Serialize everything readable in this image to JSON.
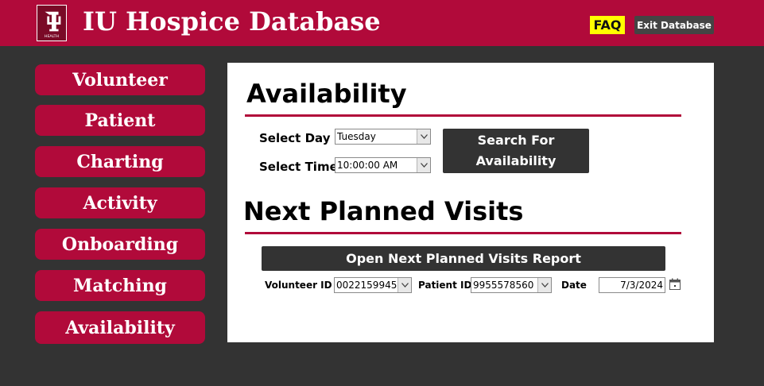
{
  "header": {
    "logo_text": "HEALTH",
    "title": "IU Hospice Database",
    "faq_label": "FAQ",
    "exit_label": "Exit Database",
    "colors": {
      "brand": "#b10a3a",
      "faq_bg": "#ffff00",
      "dark": "#333333"
    }
  },
  "nav": {
    "items": [
      {
        "label": "Volunteer"
      },
      {
        "label": "Patient"
      },
      {
        "label": "Charting"
      },
      {
        "label": "Activity"
      },
      {
        "label": "Onboarding"
      },
      {
        "label": "Matching"
      },
      {
        "label": "Availability"
      }
    ]
  },
  "availability": {
    "heading": "Availability",
    "day_label": "Select Day",
    "day_value": "Tuesday",
    "time_label": "Select Time",
    "time_value": "10:00:00 AM",
    "search_label_line1": "Search For",
    "search_label_line2": "Availability"
  },
  "next_visits": {
    "heading": "Next Planned Visits",
    "report_button_label": "Open Next Planned Visits Report",
    "volunteer_label": "Volunteer ID",
    "volunteer_value": "0022159945",
    "patient_label": "Patient ID",
    "patient_value": "9955578560",
    "date_label": "Date",
    "date_value": "7/3/2024"
  },
  "icons": {
    "logo": "iu-trident-logo-icon",
    "dropdown": "chevron-down-icon",
    "calendar": "calendar-icon"
  }
}
